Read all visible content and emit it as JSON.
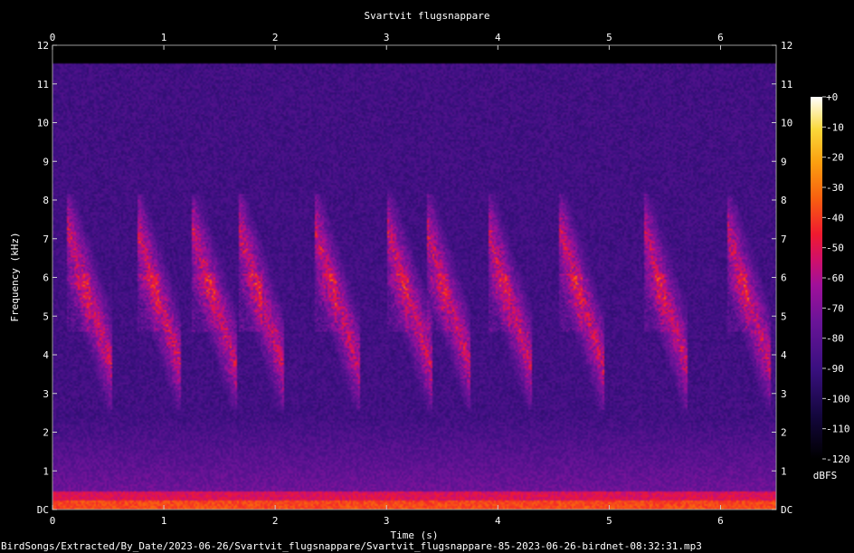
{
  "chart_data": {
    "type": "heatmap",
    "title": "Svartvit flugsnappare",
    "xlabel": "Time (s)",
    "ylabel": "Frequency (kHz)",
    "xlim": [
      0,
      6.5
    ],
    "ylim": [
      0,
      12
    ],
    "x_ticks": [
      "0",
      "1",
      "2",
      "3",
      "4",
      "5",
      "6"
    ],
    "y_ticks": [
      "DC",
      "1",
      "2",
      "3",
      "4",
      "5",
      "6",
      "7",
      "8",
      "9",
      "10",
      "11",
      "12"
    ],
    "colorbar": {
      "unit": "dBFS",
      "range": [
        -120,
        0
      ],
      "ticks": [
        "+0",
        "-10",
        "-20",
        "-30",
        "-40",
        "-50",
        "-60",
        "-70",
        "-80",
        "-90",
        "-100",
        "-110",
        "-120"
      ],
      "colormap": [
        "#000000",
        "#0a0530",
        "#2a1070",
        "#5a1590",
        "#8a10a0",
        "#c0108a",
        "#e51a45",
        "#f55a10",
        "#fa9a08",
        "#fad030",
        "#fff5a0",
        "#ffffff"
      ]
    },
    "grid": false,
    "notes": "Song phrases of energy approx. 2.5-8 kHz recurring throughout the recording; broadband low-frequency noise below 1 kHz."
  },
  "footer": {
    "file_path": "BirdSongs/Extracted/By_Date/2023-06-26/Svartvit_flugsnappare/Svartvit_flugsnappare-85-2023-06-26-birdnet-08:32:31.mp3"
  }
}
